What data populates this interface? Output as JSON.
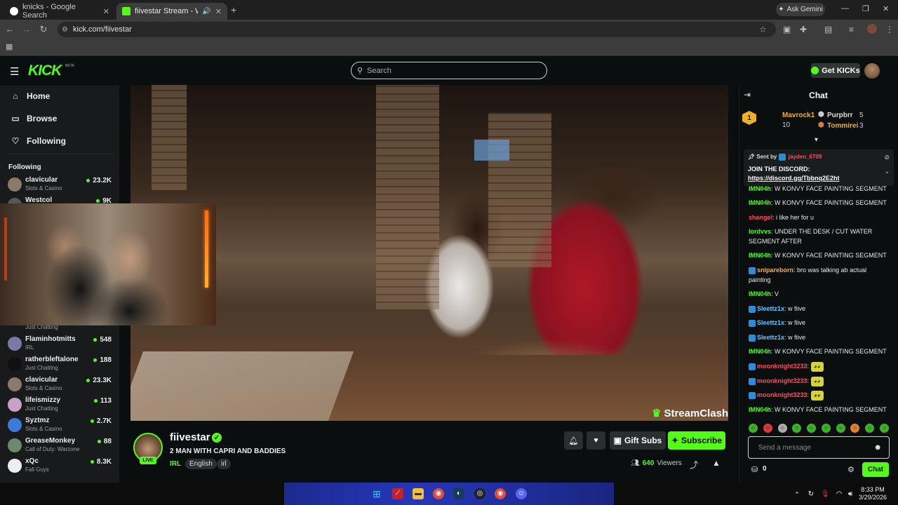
{
  "browser": {
    "tabs": [
      {
        "title": "knicks - Google Search",
        "active": false
      },
      {
        "title": "fiivestar Stream - Watch Liv",
        "active": true
      }
    ],
    "new_tab": "+",
    "url": "kick.com/fiivestar",
    "ask_gemini": "Ask Gemini"
  },
  "header": {
    "logo": "KICK",
    "beta": "BETA",
    "search_placeholder": "Search",
    "get_kicks": "Get KICKs"
  },
  "sidebar": {
    "nav": [
      {
        "label": "Home",
        "icon": "home-icon"
      },
      {
        "label": "Browse",
        "icon": "browse-icon"
      },
      {
        "label": "Following",
        "icon": "heart-icon"
      }
    ],
    "following_heading": "Following",
    "channels": [
      {
        "name": "clavicular",
        "category": "Slots & Casino",
        "viewers": "23.2K"
      },
      {
        "name": "Westcol",
        "category": "",
        "viewers": "9K"
      },
      {
        "name": "",
        "category": "Just Chatting",
        "viewers": ""
      },
      {
        "name": "Flaminhotmitts",
        "category": "IRL",
        "viewers": "548"
      },
      {
        "name": "ratherbleftalone",
        "category": "Just Chatting",
        "viewers": "188"
      },
      {
        "name": "clavicular",
        "category": "Slots & Casino",
        "viewers": "23.3K"
      },
      {
        "name": "lifeismizzy",
        "category": "Just Chatting",
        "viewers": "113"
      },
      {
        "name": "Syztmz",
        "category": "Slots & Casino",
        "viewers": "2.7K"
      },
      {
        "name": "GreaseMonkey",
        "category": "Call of Duty: Warzone",
        "viewers": "88"
      },
      {
        "name": "xQc",
        "category": "Fall Guys",
        "viewers": "8.3K"
      }
    ]
  },
  "video": {
    "overlay_brand": "StreamClash"
  },
  "stream": {
    "name": "fiivestar",
    "live": "LIVE",
    "title": "2 MAN WITH CAPRI AND BADDIES",
    "category": "IRL",
    "tags": [
      "English",
      "irl"
    ],
    "gift_subs": "Gift Subs",
    "subscribe": "Subscribe",
    "viewers_count": "640",
    "viewers_label": "Viewers"
  },
  "chat": {
    "title": "Chat",
    "leaderboard": [
      {
        "rank": "1",
        "name": "Mavrock1",
        "count": "10"
      },
      {
        "name": "Purpbrr",
        "count": "5"
      },
      {
        "name": "Tommirei",
        "count": "3"
      }
    ],
    "pinned": {
      "sent_by": "Sent by",
      "sender": "jayden_6709",
      "text": "JOIN THE DISCORD:",
      "link": "https://discord.gg/Tbbnq2E2ht"
    },
    "messages": [
      {
        "user": "IMN04h",
        "text": "W KONVY FACE PAINTING SEGMENT",
        "color": "#53fc18"
      },
      {
        "user": "IMN04h",
        "text": "W KONVY FACE PAINTING SEGMENT",
        "color": "#53fc18"
      },
      {
        "user": "shangel",
        "text": "i like her for u",
        "color": "#ff4b5c"
      },
      {
        "user": "lordvvs",
        "text": "UNDER THE DESK / CUT WATER SEGMENT AFTER",
        "color": "#53fc18"
      },
      {
        "user": "IMN04h",
        "text": "W KONVY FACE PAINTING SEGMENT",
        "color": "#53fc18"
      },
      {
        "user": "snipareborn",
        "text": "bro was talking ab actual painting",
        "color": "#ffb020"
      },
      {
        "user": "IMN04h",
        "text": "V",
        "color": "#53fc18"
      },
      {
        "user": "Sleettz1x",
        "text": "w fiive",
        "color": "#5cc8ff"
      },
      {
        "user": "Sleettz1x",
        "text": "w fiive",
        "color": "#5cc8ff"
      },
      {
        "user": "Sleettz1x",
        "text": "w fiive",
        "color": "#5cc8ff"
      },
      {
        "user": "IMN04h",
        "text": "W KONVY FACE PAINTING SEGMENT",
        "color": "#53fc18"
      },
      {
        "user": "moonknight3233",
        "text": "",
        "color": "#ff4b5c"
      },
      {
        "user": "moonknight3233",
        "text": "",
        "color": "#ff4b5c"
      },
      {
        "user": "moonknight3233",
        "text": "",
        "color": "#ff4b5c"
      },
      {
        "user": "IMN04h",
        "text": "W KONVY FACE PAINTING SEGMENT",
        "color": "#53fc18"
      }
    ],
    "input_placeholder": "Send a message",
    "kicks_count": "0",
    "send": "Chat"
  },
  "taskbar": {
    "time": "8:33 PM",
    "date": "3/29/2026"
  },
  "colors": {
    "accent": "#53fc18",
    "background": "#0b0e0f",
    "sidebar": "#181a1b"
  }
}
